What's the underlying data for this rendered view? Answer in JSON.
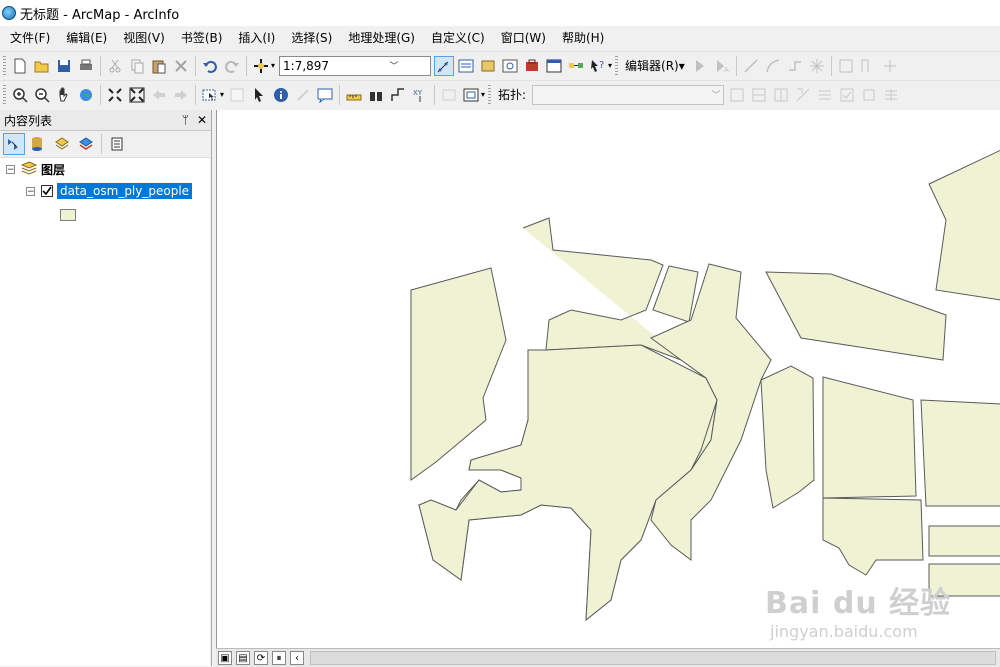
{
  "window": {
    "title": "无标题 - ArcMap - ArcInfo"
  },
  "menu": [
    "文件(F)",
    "编辑(E)",
    "视图(V)",
    "书签(B)",
    "插入(I)",
    "选择(S)",
    "地理处理(G)",
    "自定义(C)",
    "窗口(W)",
    "帮助(H)"
  ],
  "toolbar": {
    "scale_value": "1:7,897",
    "editor_label": "编辑器(R)▾",
    "topology_label": "拓扑:"
  },
  "toc": {
    "title": "内容列表",
    "pin": "ᛘ",
    "close": "✕",
    "group_name": "图层",
    "layer_name": "data_osm_ply_people",
    "layer_checked": true
  },
  "watermark": {
    "main": "Bai du 经验",
    "sub": "jingyan.baidu.com"
  },
  "colors": {
    "polygon_fill": "#eff3d4",
    "polygon_stroke": "#5a5a5a",
    "selection": "#0078d7"
  }
}
